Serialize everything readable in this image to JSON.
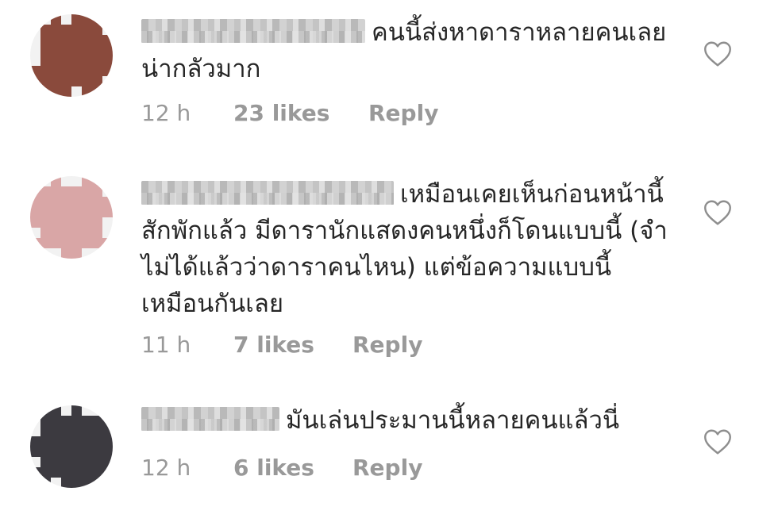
{
  "comments": [
    {
      "text": "คนนี้ส่งหาดาราหลายคนเลย น่ากลัวมาก",
      "time": "12 h",
      "likes": "23 likes",
      "reply": "Reply"
    },
    {
      "text": "เหมือนเคยเห็นก่อนหน้านี้สักพักแล้ว มีดารานักแสดงคนหนึ่งก็โดนแบบนี้ (จำไม่ได้แล้วว่าดาราคนไหน) แต่ข้อความแบบนี้เหมือนกันเลย",
      "time": "11 h",
      "likes": "7 likes",
      "reply": "Reply"
    },
    {
      "text": "มันเล่นประมานนี้หลายคนแล้วนี่",
      "time": "12 h",
      "likes": "6 likes",
      "reply": "Reply"
    }
  ],
  "icons": {
    "like": "heart-outline-icon"
  },
  "colors": {
    "text": "#262626",
    "meta": "#999999",
    "icon_stroke": "#8e8e8e"
  }
}
